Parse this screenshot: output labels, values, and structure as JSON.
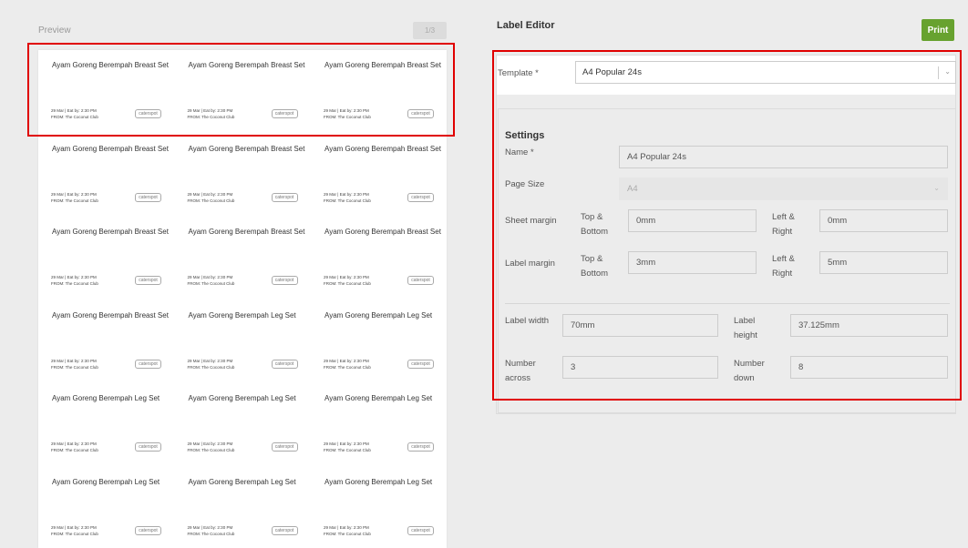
{
  "preview": {
    "title": "Preview",
    "page_indicator": "1/3",
    "labels": [
      {
        "title": "Ayam Goreng Berempah Breast Set",
        "date": "29 Mar | Eat by: 2:30 PM",
        "from": "FROM: The Coconut Club",
        "brand": "caterspot"
      },
      {
        "title": "Ayam Goreng Berempah Breast Set",
        "date": "29 Mar | Eat by: 2:30 PM",
        "from": "FROM: The Coconut Club",
        "brand": "caterspot"
      },
      {
        "title": "Ayam Goreng Berempah Breast Set",
        "date": "29 Mar | Eat by: 2:30 PM",
        "from": "FROM: The Coconut Club",
        "brand": "caterspot"
      },
      {
        "title": "Ayam Goreng Berempah Breast Set",
        "date": "29 Mar | Eat by: 2:30 PM",
        "from": "FROM: The Coconut Club",
        "brand": "caterspot"
      },
      {
        "title": "Ayam Goreng Berempah Breast Set",
        "date": "29 Mar | Eat by: 2:30 PM",
        "from": "FROM: The Coconut Club",
        "brand": "caterspot"
      },
      {
        "title": "Ayam Goreng Berempah Breast Set",
        "date": "29 Mar | Eat by: 2:30 PM",
        "from": "FROM: The Coconut Club",
        "brand": "caterspot"
      },
      {
        "title": "Ayam Goreng Berempah Breast Set",
        "date": "29 Mar | Eat by: 2:30 PM",
        "from": "FROM: The Coconut Club",
        "brand": "caterspot"
      },
      {
        "title": "Ayam Goreng Berempah Breast Set",
        "date": "29 Mar | Eat by: 2:30 PM",
        "from": "FROM: The Coconut Club",
        "brand": "caterspot"
      },
      {
        "title": "Ayam Goreng Berempah Breast Set",
        "date": "29 Mar | Eat by: 2:30 PM",
        "from": "FROM: The Coconut Club",
        "brand": "caterspot"
      },
      {
        "title": "Ayam Goreng Berempah Breast Set",
        "date": "29 Mar | Eat by: 2:30 PM",
        "from": "FROM: The Coconut Club",
        "brand": "caterspot"
      },
      {
        "title": "Ayam Goreng Berempah Leg Set",
        "date": "29 Mar | Eat by: 2:30 PM",
        "from": "FROM: The Coconut Club",
        "brand": "caterspot"
      },
      {
        "title": "Ayam Goreng Berempah Leg Set",
        "date": "29 Mar | Eat by: 2:30 PM",
        "from": "FROM: The Coconut Club",
        "brand": "caterspot"
      },
      {
        "title": "Ayam Goreng Berempah Leg Set",
        "date": "29 Mar | Eat by: 2:30 PM",
        "from": "FROM: The Coconut Club",
        "brand": "caterspot"
      },
      {
        "title": "Ayam Goreng Berempah Leg Set",
        "date": "29 Mar | Eat by: 2:30 PM",
        "from": "FROM: The Coconut Club",
        "brand": "caterspot"
      },
      {
        "title": "Ayam Goreng Berempah Leg Set",
        "date": "29 Mar | Eat by: 2:30 PM",
        "from": "FROM: The Coconut Club",
        "brand": "caterspot"
      },
      {
        "title": "Ayam Goreng Berempah Leg Set",
        "date": "29 Mar | Eat by: 2:30 PM",
        "from": "FROM: The Coconut Club",
        "brand": "caterspot"
      },
      {
        "title": "Ayam Goreng Berempah Leg Set",
        "date": "29 Mar | Eat by: 2:30 PM",
        "from": "FROM: The Coconut Club",
        "brand": "caterspot"
      },
      {
        "title": "Ayam Goreng Berempah Leg Set",
        "date": "29 Mar | Eat by: 2:30 PM",
        "from": "FROM: The Coconut Club",
        "brand": "caterspot"
      }
    ]
  },
  "editor": {
    "title": "Label Editor",
    "print_label": "Print",
    "template": {
      "label": "Template *",
      "value": "A4 Popular 24s"
    },
    "settings": {
      "heading": "Settings",
      "name_label": "Name *",
      "name_value": "A4 Popular 24s",
      "page_size_label": "Page Size",
      "page_size_value": "A4",
      "sheet_margin_label": "Sheet margin",
      "sheet_margin_tb_label": "Top & Bottom",
      "sheet_margin_tb_value": "0mm",
      "sheet_margin_lr_label": "Left & Right",
      "sheet_margin_lr_value": "0mm",
      "label_margin_label": "Label margin",
      "label_margin_tb_label": "Top & Bottom",
      "label_margin_tb_value": "3mm",
      "label_margin_lr_label": "Left & Right",
      "label_margin_lr_value": "5mm",
      "label_width_label": "Label width",
      "label_width_value": "70mm",
      "label_height_label": "Label height",
      "label_height_value": "37.125mm",
      "number_across_label": "Number across",
      "number_across_value": "3",
      "number_down_label": "Number down",
      "number_down_value": "8"
    }
  },
  "colors": {
    "print_button": "#67a22f",
    "highlight": "#e00000"
  }
}
